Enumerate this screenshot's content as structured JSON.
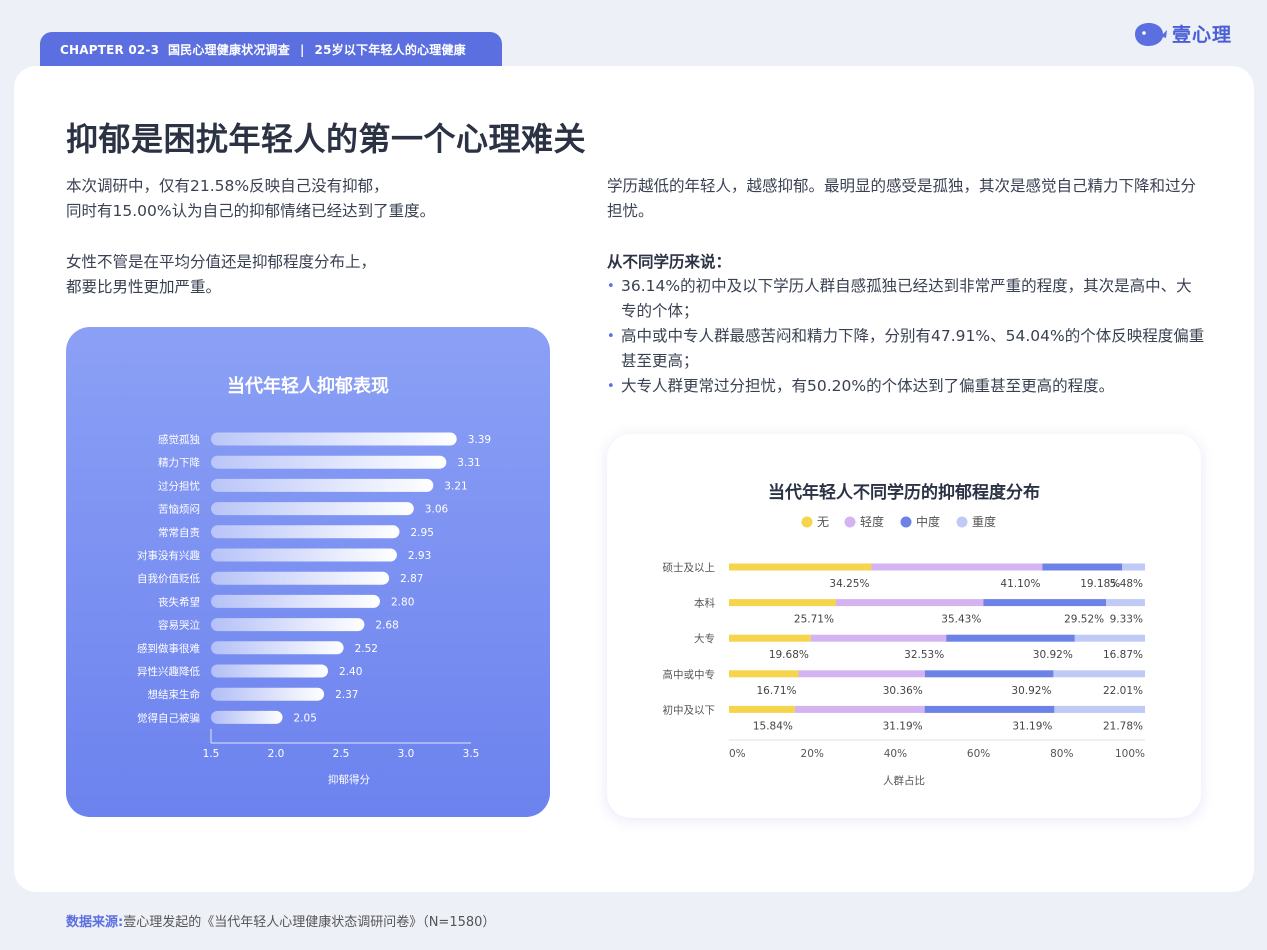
{
  "chapter": {
    "code": "CHAPTER 02-3",
    "section": "国民心理健康状况调查",
    "separator": "|",
    "topic": "25岁以下年轻人的心理健康"
  },
  "logo": {
    "text": "壹心理",
    "icon": "whale-logo-icon"
  },
  "title": "抑郁是困扰年轻人的第一个心理难关",
  "left_text": {
    "p1_line1": "本次调研中，仅有21.58%反映自己没有抑郁，",
    "p1_line2": "同时有15.00%认为自己的抑郁情绪已经达到了重度。",
    "p2_line1": "女性不管是在平均分值还是抑郁程度分布上，",
    "p2_line2": "都要比男性更加严重。"
  },
  "right_text": {
    "intro": "学历越低的年轻人，越感抑郁。最明显的感受是孤独，其次是感觉自己精力下降和过分担忧。",
    "subhead": "从不同学历来说：",
    "bullets": [
      " 36.14%的初中及以下学历人群自感孤独已经达到非常严重的程度，其次是高中、大专的个体；",
      "高中或中专人群最感苦闷和精力下降，分别有47.91%、54.04%的个体反映程度偏重甚至更高；",
      "大专人群更常过分担忧，有50.20%的个体达到了偏重甚至更高的程度。"
    ]
  },
  "chart_data": [
    {
      "type": "bar",
      "orientation": "horizontal",
      "title": "当代年轻人抑郁表现",
      "xlabel": "抑郁得分",
      "ylabel": "",
      "categories": [
        "感觉孤独",
        "精力下降",
        "过分担忧",
        "苦恼烦闷",
        "常常自责",
        "对事没有兴趣",
        "自我价值贬低",
        "丧失希望",
        "容易哭泣",
        "感到做事很难",
        "异性兴趣降低",
        "想结束生命",
        "觉得自己被骗"
      ],
      "values": [
        3.39,
        3.31,
        3.21,
        3.06,
        2.95,
        2.93,
        2.87,
        2.8,
        2.68,
        2.52,
        2.4,
        2.37,
        2.05
      ],
      "value_labels": [
        "3.39",
        "3.31",
        "3.21",
        "3.06",
        "2.95",
        "2.93",
        "2.87",
        "2.80",
        "2.68",
        "2.52",
        "2.40",
        "2.37",
        "2.05"
      ],
      "xlim": [
        1.5,
        3.5
      ],
      "xticks": [
        "1.5",
        "2.0",
        "2.5",
        "3.0",
        "3.5"
      ],
      "grid": false,
      "bar_color": "#ffffff"
    },
    {
      "type": "bar",
      "orientation": "horizontal",
      "stacked": true,
      "title": "当代年轻人不同学历的抑郁程度分布",
      "xlabel": "人群占比",
      "ylabel": "",
      "categories": [
        "硕士及以上",
        "本科",
        "大专",
        "高中或中专",
        "初中及以下"
      ],
      "series": [
        {
          "name": "无",
          "color": "#f6d44b",
          "values": [
            34.25,
            25.71,
            19.68,
            16.71,
            15.84
          ],
          "labels": [
            "34.25%",
            "25.71%",
            "19.68%",
            "16.71%",
            "15.84%"
          ]
        },
        {
          "name": "轻度",
          "color": "#d3b3f2",
          "values": [
            41.1,
            35.43,
            32.53,
            30.36,
            31.19
          ],
          "labels": [
            "41.10%",
            "35.43%",
            "32.53%",
            "30.36%",
            "31.19%"
          ]
        },
        {
          "name": "中度",
          "color": "#6c82e6",
          "values": [
            19.18,
            29.52,
            30.92,
            30.92,
            31.19
          ],
          "labels": [
            "19.18%",
            "29.52%",
            "30.92%",
            "30.92%",
            "31.19%"
          ]
        },
        {
          "name": "重度",
          "color": "#bfcaf6",
          "values": [
            5.48,
            9.33,
            16.87,
            22.01,
            21.78
          ],
          "labels": [
            "5.48%",
            "9.33%",
            "16.87%",
            "22.01%",
            "21.78%"
          ]
        }
      ],
      "xlim": [
        0,
        100
      ],
      "xticks": [
        "0%",
        "20%",
        "40%",
        "60%",
        "80%",
        "100%"
      ],
      "legend_position": "top-center",
      "grid": false
    }
  ],
  "source": {
    "label": "数据来源:",
    "text": "壹心理发起的《当代年轻人心理健康状态调研问卷》（N=1580）"
  }
}
